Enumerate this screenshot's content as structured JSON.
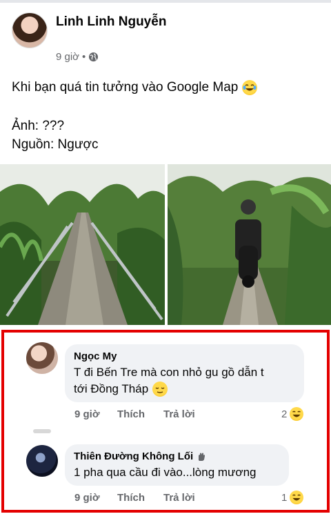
{
  "post": {
    "author": "Linh Linh Nguyễn",
    "time": "9 giờ",
    "separator": "•",
    "line1": "Khi bạn quá tin tưởng vào Google Map",
    "line2": "Ảnh: ???",
    "line3": "Nguồn:  Ngược"
  },
  "comments": [
    {
      "name": "Ngọc My",
      "text_line1": "T đi Bến Tre mà con nhỏ gu gồ dẫn t",
      "text_line2": "tới Đồng Tháp",
      "time": "9 giờ",
      "like": "Thích",
      "reply": "Trả lời",
      "reactions": "2"
    },
    {
      "name": "Thiên Đường Không Lối",
      "text_line1": "1 pha qua cầu đi vào...lòng mương",
      "time": "9 giờ",
      "like": "Thích",
      "reply": "Trả lời",
      "reactions": "1"
    }
  ],
  "colors": {
    "frame": "#e40000",
    "bubble": "#f0f2f5",
    "muted": "#65676b"
  },
  "icons": [
    "globe-icon",
    "laughing-emoji",
    "relieved-emoji",
    "haha-reaction-icon",
    "wave-badge-icon"
  ]
}
